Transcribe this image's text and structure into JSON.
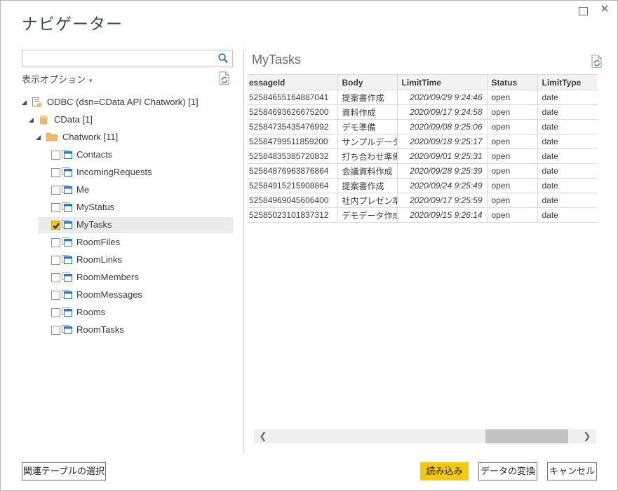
{
  "window": {
    "title": "ナビゲーター",
    "icons": {
      "maximize": "□",
      "close": "✕"
    }
  },
  "colors": {
    "accent_yellow": "#f2c811",
    "table_icon_blue": "#2e79bd",
    "tree_icon_tan": "#e6bd6d",
    "search_icon_blue": "#3b6ea5",
    "refresh_green": "#2da05e"
  },
  "sidebar": {
    "search": {
      "value": "",
      "placeholder": ""
    },
    "display_options": {
      "label": "表示オプション",
      "caret": "▾"
    },
    "tree": [
      {
        "label": "ODBC (dsn=CData API Chatwork) [1]",
        "level": 0,
        "icon": "odbc-icon",
        "expanded": true
      },
      {
        "label": "CData [1]",
        "level": 1,
        "icon": "database-icon",
        "expanded": true
      },
      {
        "label": "Chatwork [11]",
        "level": 2,
        "icon": "folder-icon",
        "expanded": true
      },
      {
        "label": "Contacts",
        "icon": "table-icon",
        "checked": false
      },
      {
        "label": "IncomingRequests",
        "icon": "table-icon",
        "checked": false
      },
      {
        "label": "Me",
        "icon": "table-icon",
        "checked": false
      },
      {
        "label": "MyStatus",
        "icon": "table-icon",
        "checked": false
      },
      {
        "label": "MyTasks",
        "icon": "table-icon",
        "checked": true
      },
      {
        "label": "RoomFiles",
        "icon": "table-icon",
        "checked": false
      },
      {
        "label": "RoomLinks",
        "icon": "table-icon",
        "checked": false
      },
      {
        "label": "RoomMembers",
        "icon": "table-icon",
        "checked": false
      },
      {
        "label": "RoomMessages",
        "icon": "table-icon",
        "checked": false
      },
      {
        "label": "Rooms",
        "icon": "table-icon",
        "checked": false
      },
      {
        "label": "RoomTasks",
        "icon": "table-icon",
        "checked": false
      }
    ]
  },
  "preview": {
    "title": "MyTasks",
    "columns": [
      "essageId",
      "Body",
      "LimitTime",
      "Status",
      "LimitType"
    ],
    "rows": [
      [
        "52584655164887041",
        "提案書作成",
        "2020/09/29 9:24:46",
        "open",
        "date"
      ],
      [
        "52584693626675200",
        "資料作成",
        "2020/09/17 9:24:58",
        "open",
        "date"
      ],
      [
        "52584735435476992",
        "デモ準備",
        "2020/09/08 9:25:06",
        "open",
        "date"
      ],
      [
        "52584799511859200",
        "サンプルデータ作成",
        "2020/09/18 9:25:17",
        "open",
        "date"
      ],
      [
        "52584835385720832",
        "打ち合わせ準備",
        "2020/09/01 9:25:31",
        "open",
        "date"
      ],
      [
        "52584876963876864",
        "会議資料作成",
        "2020/09/28 9:25:39",
        "open",
        "date"
      ],
      [
        "52584915215908864",
        "提案書作成",
        "2020/09/24 9:25:49",
        "open",
        "date"
      ],
      [
        "52584969045606400",
        "社内プレゼン準備",
        "2020/09/17 9:25:59",
        "open",
        "date"
      ],
      [
        "52585023101837312",
        "デモデータ作成",
        "2020/09/15 9:26:14",
        "open",
        "date"
      ]
    ]
  },
  "scrollbar": {
    "left_arrow": "❮",
    "right_arrow": "❯"
  },
  "footer": {
    "select_related_label": "関連テーブルの選択",
    "load_label": "読み込み",
    "transform_label": "データの変換",
    "cancel_label": "キャンセル"
  }
}
